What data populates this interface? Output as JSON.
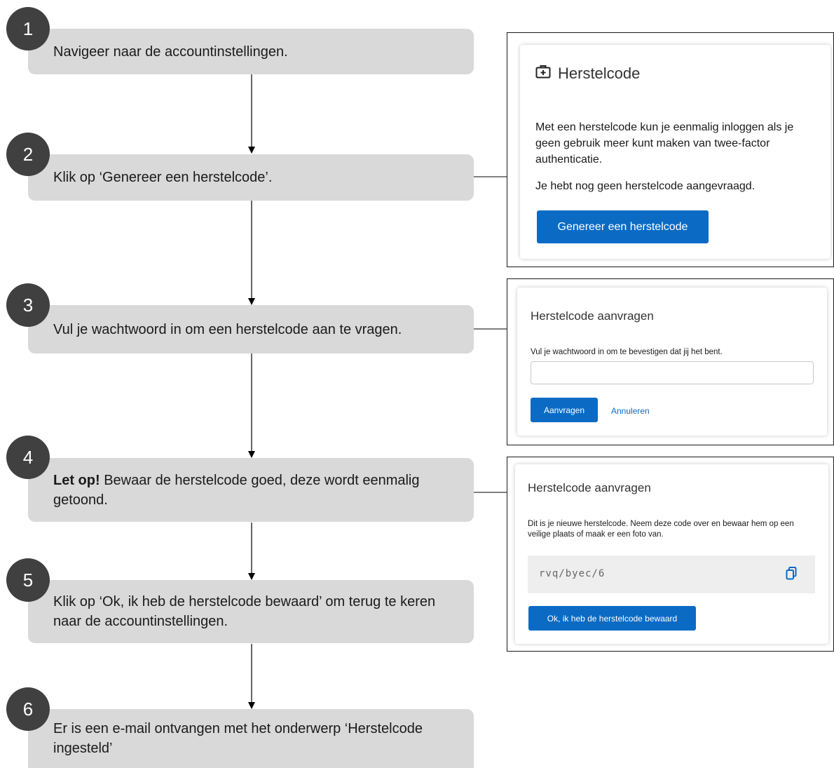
{
  "steps": [
    {
      "number": "1",
      "text": "Navigeer naar de accountinstellingen."
    },
    {
      "number": "2",
      "text": "Klik op ‘Genereer een herstelcode’."
    },
    {
      "number": "3",
      "text": "Vul je wachtwoord in om een herstelcode aan te vragen."
    },
    {
      "number": "4",
      "bold": "Let op!",
      "text": " Bewaar de herstelcode goed, deze wordt eenmalig getoond."
    },
    {
      "number": "5",
      "text": "Klik op ‘Ok, ik heb de herstelcode bewaard’ om terug te keren naar de accountinstellingen."
    },
    {
      "number": "6",
      "text": "Er is een e-mail ontvangen met het onderwerp ‘Herstelcode ingesteld’"
    }
  ],
  "card_herstelcode": {
    "title": "Herstelcode",
    "icon": "medical-kit-icon",
    "description": "Met een herstelcode kun je eenmalig inloggen als je geen gebruik meer kunt maken van twee-factor authenticatie.",
    "status": "Je hebt nog geen herstelcode aangevraagd.",
    "button": "Genereer een herstelcode"
  },
  "card_password": {
    "title": "Herstelcode aanvragen",
    "description": "Vul je wachtwoord in om te bevestigen dat jij het bent.",
    "input_value": "",
    "submit": "Aanvragen",
    "cancel": "Annuleren"
  },
  "card_code": {
    "title": "Herstelcode aanvragen",
    "description": "Dit is je nieuwe herstelcode. Neem deze code over en bewaar hem op een veilige plaats of maak er een foto van.",
    "code": "rvq/byec/6",
    "copy_icon": "copy-icon",
    "button": "Ok, ik heb de herstelcode bewaard"
  },
  "colors": {
    "step_box": "#d9d9d9",
    "badge": "#404040",
    "primary": "#0b6bc4"
  }
}
